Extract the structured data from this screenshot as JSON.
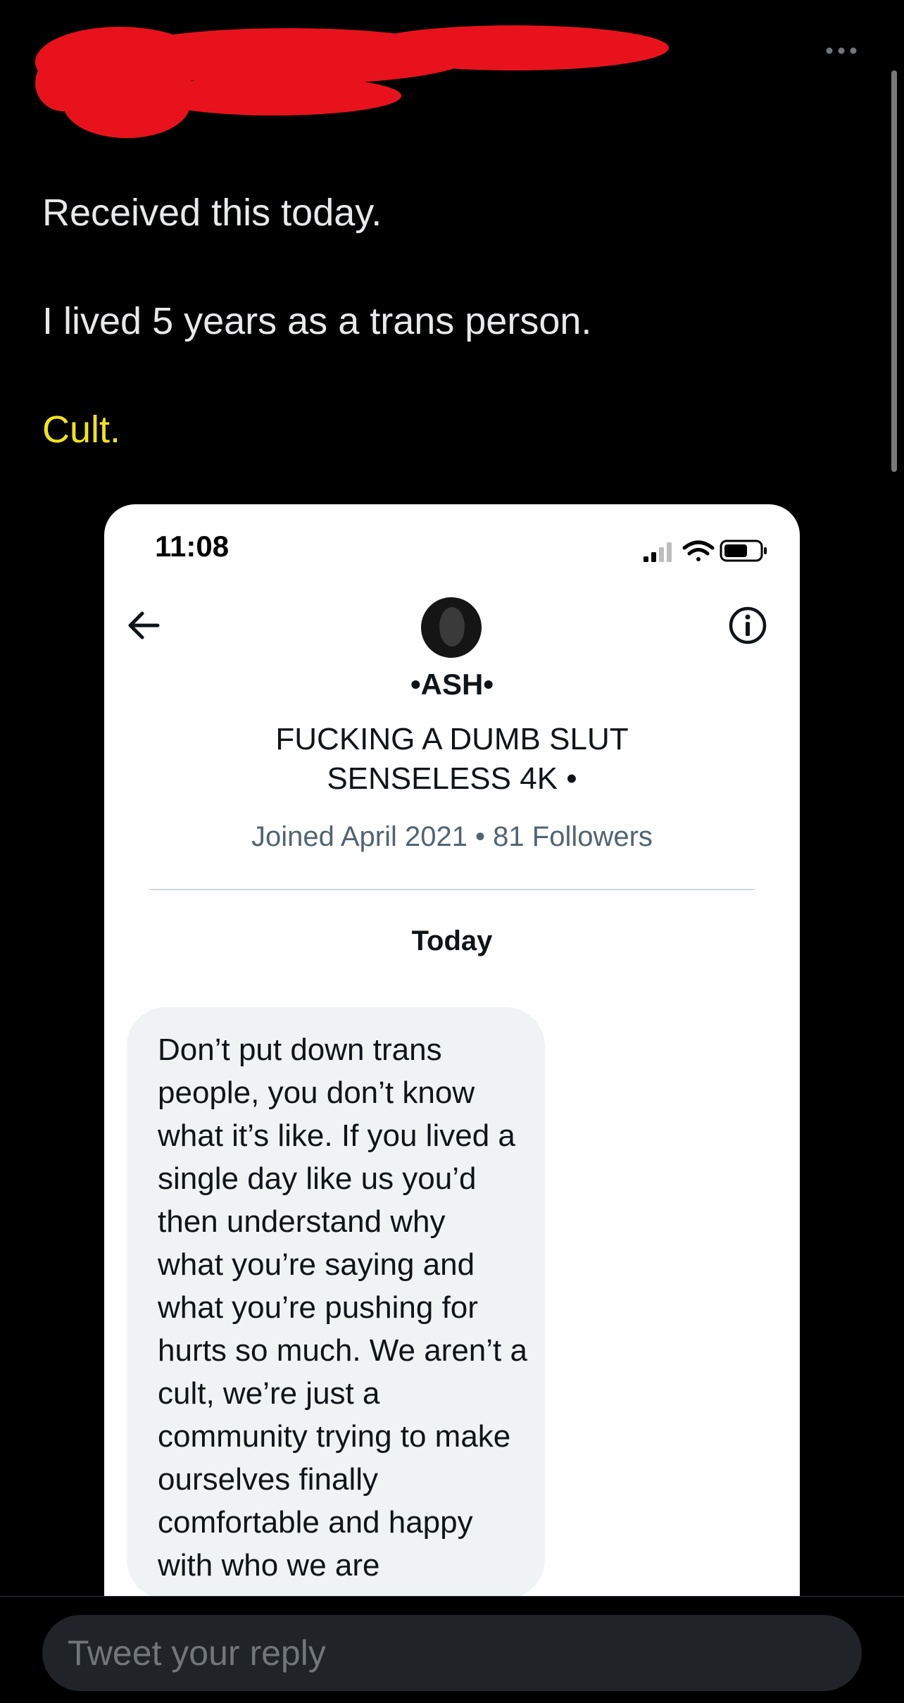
{
  "tweet": {
    "lines": [
      "Received this today.",
      "I lived 5 years as a trans person.",
      "Cult."
    ]
  },
  "embedded_screenshot": {
    "status_time": "11:08",
    "profile_name": "•ASH•",
    "profile_bio_lines": [
      "FUCKING A DUMB SLUT",
      "SENSELESS 4K •"
    ],
    "profile_meta": "Joined April 2021 • 81 Followers",
    "date_separator": "Today",
    "message_lines": [
      "Don’t put down trans",
      "people, you don’t know",
      "what it’s like. If you lived a",
      "single day like us you’d",
      "then understand why",
      "what you’re saying and",
      "what you’re pushing for",
      "hurts so much. We aren’t a",
      "cult, we’re just a",
      "community trying to make",
      "ourselves finally",
      "comfortable and happy",
      "with who we are"
    ]
  },
  "reply": {
    "placeholder": "Tweet your reply"
  },
  "colors": {
    "background": "#000000",
    "text": "#e7e9ea",
    "highlight": "#f2e41a",
    "redaction": "#e8121c",
    "bubble": "#eff3f4"
  }
}
